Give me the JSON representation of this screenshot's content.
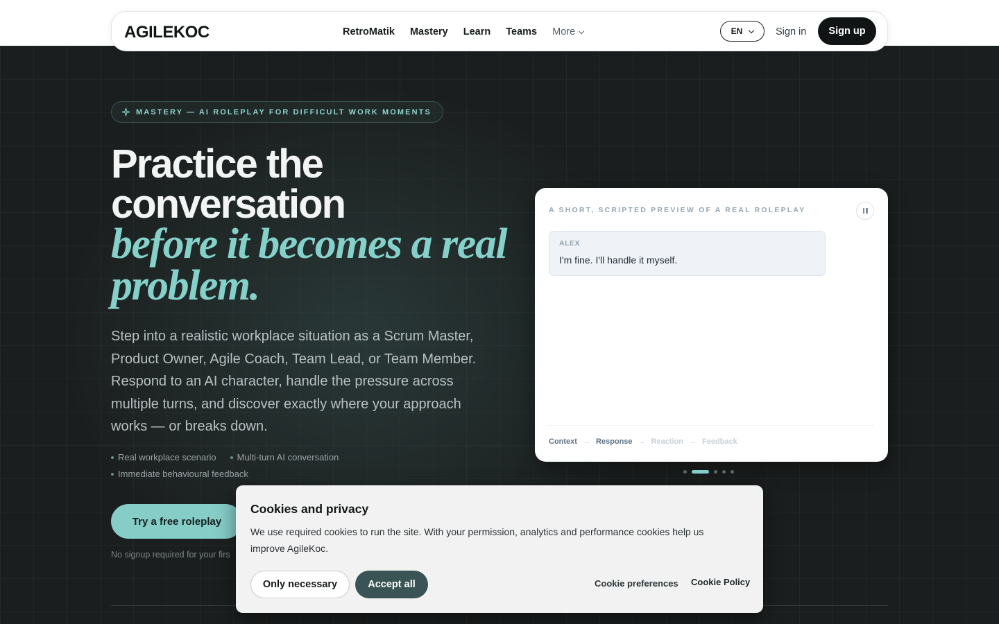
{
  "header": {
    "logo_text": "AGILEKOC",
    "nav": [
      "RetroMatik",
      "Mastery",
      "Learn",
      "Teams"
    ],
    "more_label": "More",
    "language": "EN",
    "signin_label": "Sign in",
    "signup_label": "Sign up"
  },
  "hero": {
    "pill_label": "MASTERY — AI ROLEPLAY FOR DIFFICULT WORK MOMENTS",
    "title_line1": "Practice the",
    "title_line2": "conversation",
    "title_accent": "before it becomes a real problem.",
    "description": "Step into a realistic workplace situation as a Scrum Master, Product Owner, Agile Coach, Team Lead, or Team Member. Respond to an AI character, handle the pressure across multiple turns, and discover exactly where your approach works — or breaks down.",
    "bullets": [
      "Real workplace scenario",
      "Multi-turn AI conversation",
      "Immediate behavioural feedback"
    ],
    "cta_label": "Try a free roleplay",
    "cta_note": "No signup required for your firs"
  },
  "preview": {
    "kicker": "A SHORT, SCRIPTED PREVIEW OF A REAL ROLEPLAY",
    "message": {
      "speaker": "ALEX",
      "text": "I'm fine. I'll handle it myself."
    },
    "steps": [
      "Context",
      "Response",
      "Reaction",
      "Feedback"
    ],
    "steps_completed": 2,
    "slide_count": 5,
    "active_slide": 2
  },
  "cookie": {
    "title": "Cookies and privacy",
    "text": "We use required cookies to run the site. With your permission, analytics and performance cookies help us improve AgileKoc.",
    "only_necessary_label": "Only necessary",
    "accept_all_label": "Accept all",
    "preferences_label": "Cookie preferences",
    "policy_label": "Cookie Policy"
  },
  "colors": {
    "accent": "#86d0ca",
    "dark": "#111414",
    "cookie_accept": "#3a5354"
  }
}
